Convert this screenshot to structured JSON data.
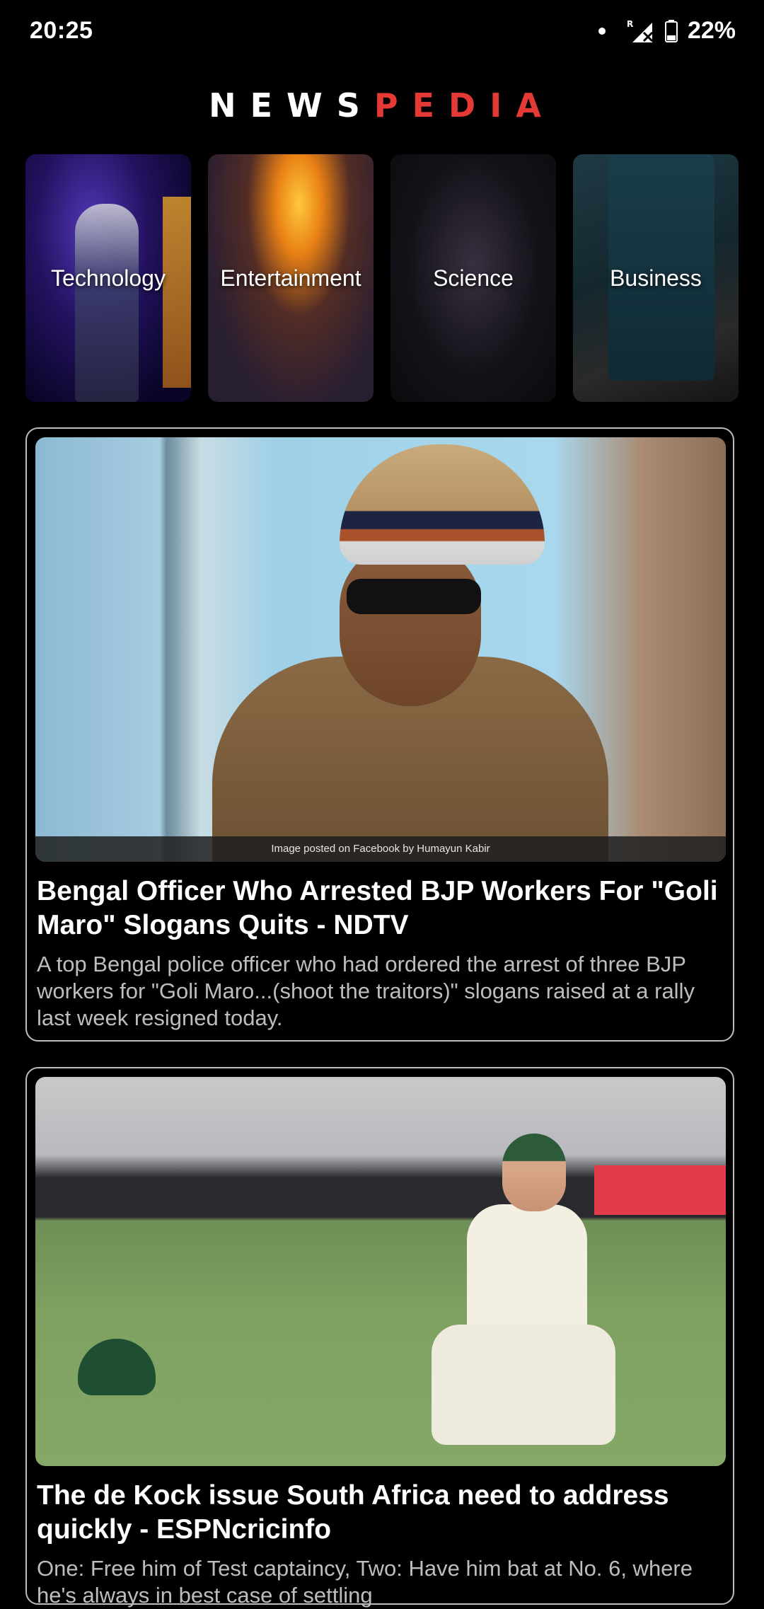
{
  "status_bar": {
    "time": "20:25",
    "network_label": "R",
    "battery": "22%"
  },
  "brand": {
    "part1": "NEWS",
    "part2": "PEDIA",
    "accent_color": "#e53935"
  },
  "categories": [
    {
      "label": "Technology"
    },
    {
      "label": "Entertainment"
    },
    {
      "label": "Science"
    },
    {
      "label": "Business"
    }
  ],
  "articles": [
    {
      "title": "Bengal Officer Who Arrested BJP Workers For \"Goli Maro\" Slogans Quits - NDTV",
      "description": "A top Bengal police officer who had ordered the arrest of three BJP workers for \"Goli Maro...(shoot the traitors)\" slogans raised at a rally last week resigned today.",
      "image_caption": "Image posted on Facebook by Humayun Kabir"
    },
    {
      "title": "The de Kock issue South Africa need to address quickly - ESPNcricinfo",
      "description": "One: Free him of Test captaincy, Two: Have him bat at No. 6, where he's always in best case of settling",
      "image_caption": ""
    }
  ]
}
